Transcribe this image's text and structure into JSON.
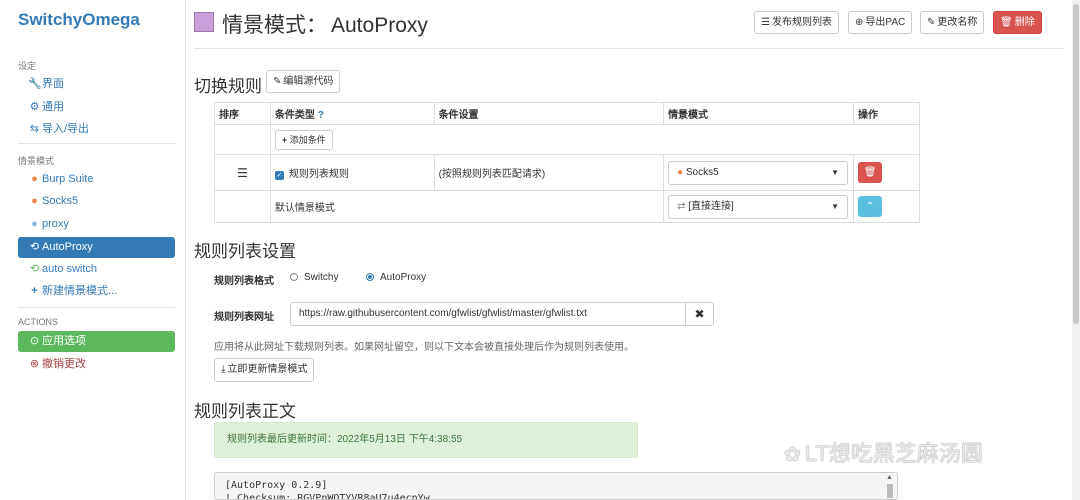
{
  "app": {
    "brand": "SwitchyOmega"
  },
  "sidebar": {
    "settings_header": "设定",
    "settings_items": [
      {
        "icon": "wrench-icon",
        "glyph": "🔧",
        "label": "界面"
      },
      {
        "icon": "gear-icon",
        "glyph": "⚙",
        "label": "通用"
      },
      {
        "icon": "import-export-icon",
        "glyph": "⇆",
        "label": "导入/导出"
      }
    ],
    "profiles_header": "情景模式",
    "profiles": [
      {
        "icon": "globe-icon",
        "glyph": "●",
        "color": "#e8894c",
        "label": "Burp Suite"
      },
      {
        "icon": "globe-icon",
        "glyph": "●",
        "color": "#e8894c",
        "label": "Socks5"
      },
      {
        "icon": "globe-icon",
        "glyph": "●",
        "color": "#8fb6e0",
        "label": "proxy"
      },
      {
        "icon": "switch-icon",
        "glyph": "⟲",
        "color": "#ffffff",
        "label": "AutoProxy"
      },
      {
        "icon": "switch-icon",
        "glyph": "⟲",
        "color": "#5cb85c",
        "label": "auto switch"
      },
      {
        "icon": "plus-icon",
        "glyph": "+",
        "color": "#337ab7",
        "label": "新建情景模式..."
      }
    ],
    "actions_header": "ACTIONS",
    "apply_label": "应用选项",
    "discard_label": "撤销更改"
  },
  "header": {
    "title": "情景模式：",
    "profile_name": "AutoProxy",
    "profile_color": "#c9a0dc",
    "buttons": {
      "publish": "发布规则列表",
      "export_pac": "导出PAC",
      "rename": "更改名称",
      "delete": "删除"
    }
  },
  "switch_rules": {
    "title": "切换规则",
    "edit_source": "编辑源代码",
    "columns": [
      "排序",
      "条件类型",
      "条件设置",
      "情景模式",
      "操作"
    ],
    "add_condition": "添加条件",
    "rows": [
      {
        "type": "规则列表规则",
        "setting": "(按照规则列表匹配请求)",
        "profile": "Socks5"
      }
    ],
    "default_label": "默认情景模式",
    "default_profile": "[直接连接]"
  },
  "rule_list_settings": {
    "title": "规则列表设置",
    "format_label": "规则列表格式",
    "format_options": [
      "Switchy",
      "AutoProxy"
    ],
    "selected_format": "AutoProxy",
    "url_label": "规则列表网址",
    "url_value": "https://raw.githubusercontent.com/gfwlist/gfwlist/master/gfwlist.txt",
    "help_text": "应用将从此网址下载规则列表。如果网址留空，则以下文本会被直接处理后作为规则列表使用。",
    "update_button": "立即更新情景模式"
  },
  "rule_list_text": {
    "title": "规则列表正文",
    "last_updated": "规则列表最后更新时间：2022年5月13日 下午4:38:55",
    "lines": [
      "[AutoProxy 0.2.9]",
      "! Checksum: RGVPnWQTYVR8aU7u4ecnYw"
    ]
  },
  "watermark": {
    "text": "LT想吃黑芝麻汤圆"
  }
}
